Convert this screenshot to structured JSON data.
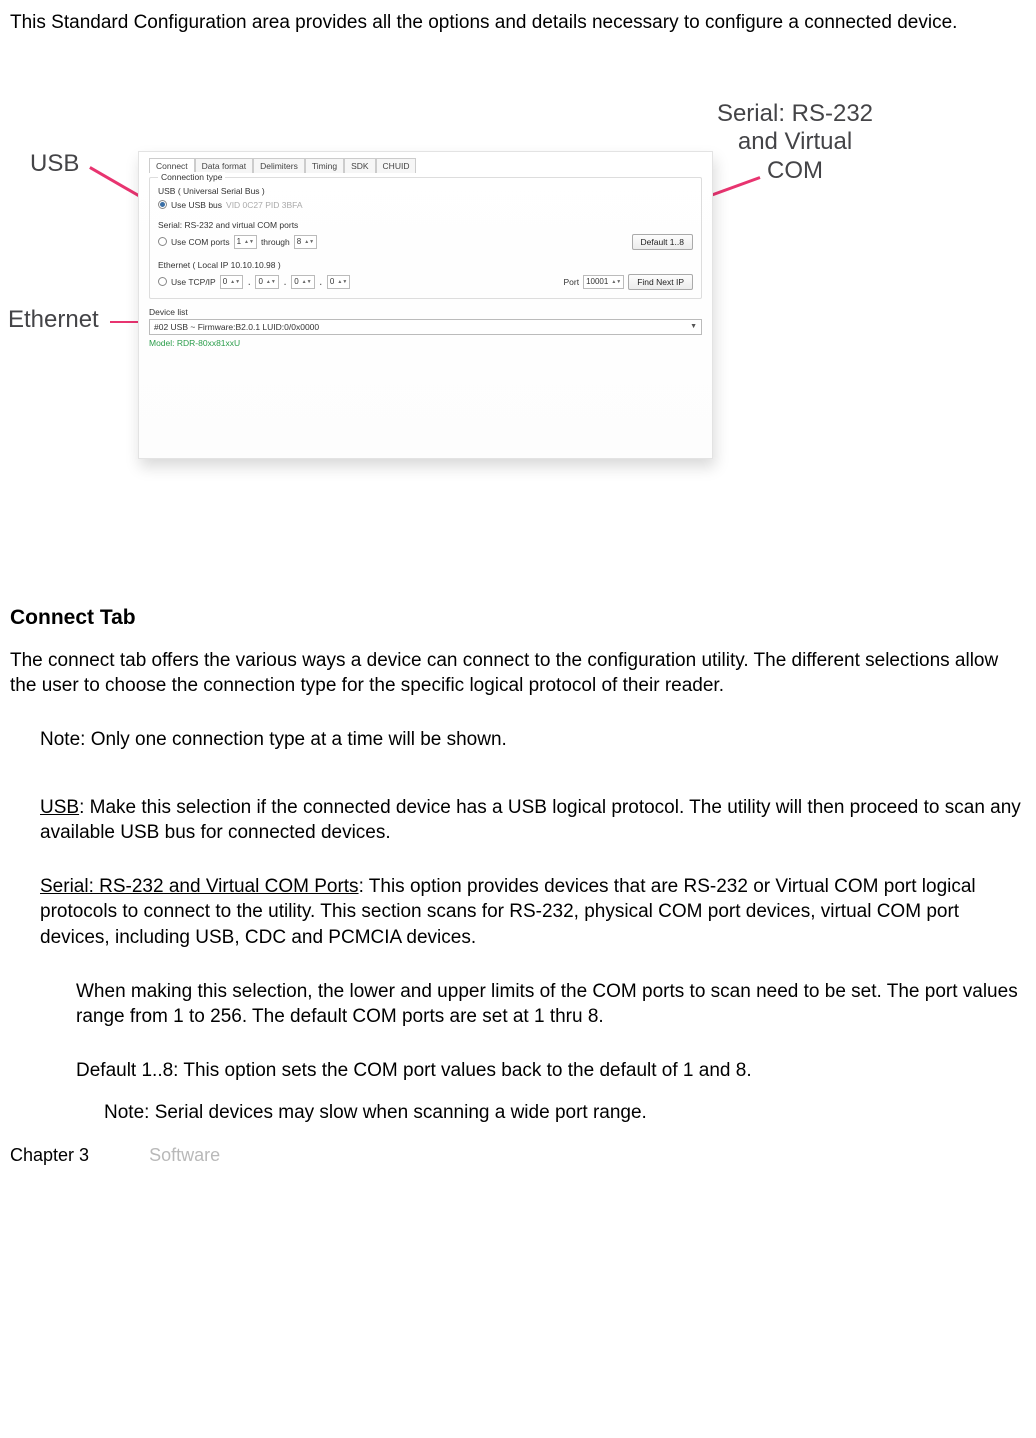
{
  "intro": "This Standard Configuration area provides all the options and details necessary to configure a connected device.",
  "diagram": {
    "labels": {
      "usb": "USB",
      "ethernet": "Ethernet",
      "serial": "Serial: RS-232 and Virtual COM"
    },
    "panel": {
      "tabs": [
        "Connect",
        "Data format",
        "Delimiters",
        "Timing",
        "SDK",
        "CHUID"
      ],
      "connection_type_title": "Connection type",
      "usb_group": {
        "title": "USB ( Universal Serial Bus )",
        "radio_label": "Use USB bus",
        "detail": "VID 0C27 PID 3BFA"
      },
      "serial_group": {
        "title": "Serial: RS-232 and virtual COM ports",
        "radio_label": "Use COM ports",
        "from": "1",
        "through_label": "through",
        "to": "8",
        "default_btn": "Default 1..8"
      },
      "ethernet_group": {
        "title": "Ethernet ( Local IP 10.10.10.98 )",
        "radio_label": "Use TCP/IP",
        "ip1": "0",
        "ip2": "0",
        "ip3": "0",
        "ip4": "0",
        "port_label": "Port",
        "port": "10001",
        "find_btn": "Find Next IP"
      },
      "device_list": {
        "heading": "Device list",
        "selected": "#02 USB ~ Firmware:B2.0.1 LUID:0/0x0000",
        "model": "Model: RDR-80xx81xxU"
      }
    }
  },
  "connect_tab": {
    "heading": "Connect Tab",
    "para1": "The connect tab offers the various ways a device can connect to the configuration utility. The different selections allow the user to choose the connection type for the specific logical protocol of their reader.",
    "note1": "Note: Only one connection type at a time will be shown.",
    "usb_label": "USB",
    "usb_text": ": Make  this selection if the connected  device has a USB logical protocol. The utility will then proceed to scan any available  USB bus for connected devices.",
    "serial_label": "Serial: RS-232 and Virtual COM Ports",
    "serial_text": ": This option provides devices that are RS-232 or Virtual COM port logical protocols to connect to the utility. This section scans for RS-232, physical COM port devices, virtual COM port devices, including USB, CDC and PCMCIA devices.",
    "serial_sub1": "When making this selection, the lower and upper limits of the COM ports to scan need to be set. The port values range from 1 to 256. The default COM ports are set at 1 thru 8.",
    "serial_sub2": "Default 1..8: This option sets the COM port values back to the default of 1 and  8.",
    "note2": "Note: Serial devices may slow when scanning a wide port range."
  },
  "footer": {
    "chapter": "Chapter 3",
    "software": "Software"
  }
}
